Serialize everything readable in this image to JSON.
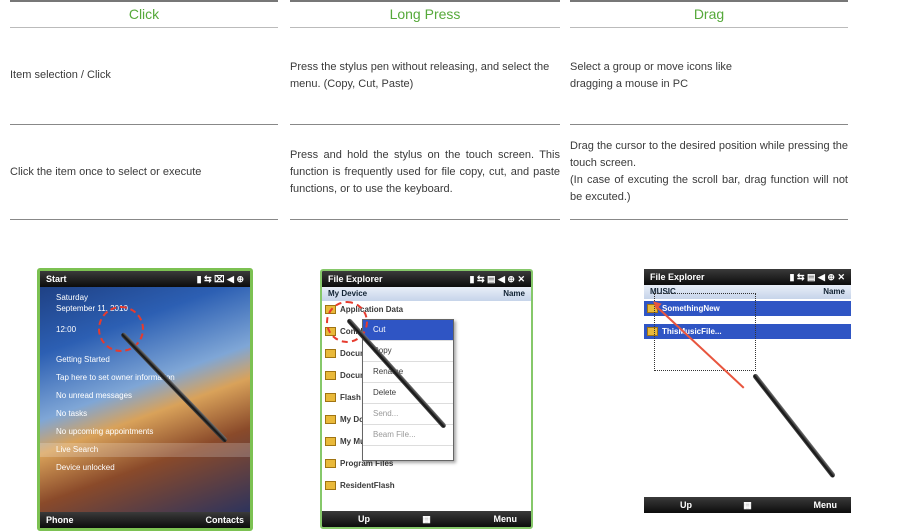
{
  "columns": [
    {
      "title": "Click",
      "row1": "Item selection / Click",
      "row2": "Click the item once to select or execute"
    },
    {
      "title": "Long Press",
      "row1": "Press the stylus pen without releasing, and select the menu. (Copy, Cut, Paste)",
      "row2": "Press and hold the stylus on the touch screen. This function is frequently used for file copy, cut, and paste functions, or to use the keyboard."
    },
    {
      "title": "Drag",
      "row1": "Select a group or move icons like dragging a mouse in PC",
      "row2": "Drag the cursor to the desired position while pressing the touch screen.",
      "row2b": "(In case of excuting the scroll bar, drag function will not be excuted.)"
    }
  ],
  "screens": {
    "click": {
      "title": "Start",
      "date_day": "Saturday",
      "date_full": "September 11, 2010",
      "time": "12:00",
      "items": [
        "Getting Started",
        "Tap here to set owner information",
        "No unread messages",
        "No tasks",
        "No upcoming appointments",
        "Live Search",
        "Device unlocked"
      ],
      "soft_left": "Phone",
      "soft_right": "Contacts"
    },
    "long_press": {
      "title": "File Explorer",
      "location": "My Device",
      "sort": "Name",
      "files": [
        "Application Data",
        "ConnMgr",
        "Documents and Settings",
        "Documents",
        "Flash",
        "My Documents",
        "My Music",
        "Program Files",
        "ResidentFlash"
      ],
      "menu": [
        "Cut",
        "Copy",
        "Rename",
        "Delete",
        "Send...",
        "Beam File..."
      ],
      "soft_left": "Up",
      "soft_right": "Menu"
    },
    "drag": {
      "title": "File Explorer",
      "location": "MUSIC",
      "sort": "Name",
      "files": [
        "SomethingNew",
        "ThisMusicFile..."
      ],
      "soft_left": "Up",
      "soft_right": "Menu"
    }
  },
  "colors": {
    "header_text": "#56a93a",
    "frame_green": "#7cc152",
    "selection_blue": "#2f55c4",
    "drag_arrow": "#e8553e"
  }
}
